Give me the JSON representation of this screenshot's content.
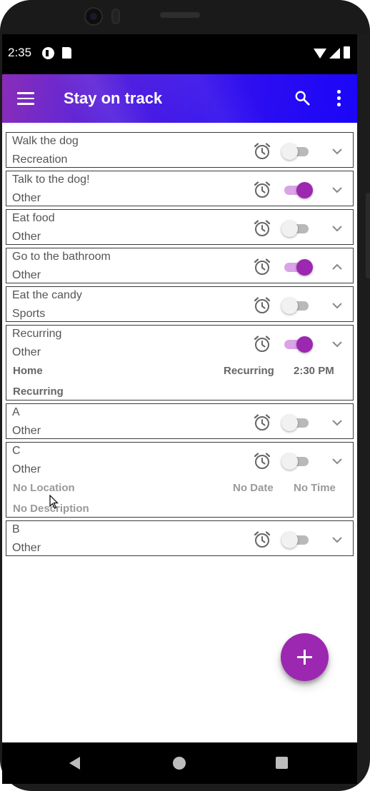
{
  "status_bar": {
    "time": "2:35"
  },
  "app_bar": {
    "title": "Stay on track",
    "menu_icon": "hamburger-menu-icon",
    "search_icon": "search-icon",
    "overflow_icon": "more-vert-icon",
    "gradient_colors": [
      "#8a2db8",
      "#1a06f8"
    ]
  },
  "accent_color": "#9c27b0",
  "tasks": [
    {
      "title": "Walk the dog",
      "category": "Recreation",
      "enabled": false,
      "expanded": false
    },
    {
      "title": "Talk to the dog!",
      "category": "Other",
      "enabled": true,
      "expanded": false
    },
    {
      "title": "Eat food",
      "category": "Other",
      "enabled": false,
      "expanded": false
    },
    {
      "title": "Go to the bathroom",
      "category": "Other",
      "enabled": true,
      "expanded": true
    },
    {
      "title": "Eat the candy",
      "category": "Sports",
      "enabled": false,
      "expanded": false
    },
    {
      "title": "Recurring",
      "category": "Other",
      "enabled": true,
      "expanded": false,
      "details": {
        "location": "Home",
        "date": "Recurring",
        "time": "2:30 PM",
        "description": "Recurring"
      }
    },
    {
      "title": "A",
      "category": "Other",
      "enabled": false,
      "expanded": false
    },
    {
      "title": "C",
      "category": "Other",
      "enabled": false,
      "expanded": false,
      "details": {
        "location": "No Location",
        "date": "No Date",
        "time": "No Time",
        "description": "No Description"
      }
    },
    {
      "title": "B",
      "category": "Other",
      "enabled": false,
      "expanded": false
    }
  ],
  "fab": {
    "icon": "add-icon"
  },
  "nav_bar": {
    "back_icon": "back-triangle-icon",
    "home_icon": "home-circle-icon",
    "recents_icon": "recents-square-icon"
  }
}
